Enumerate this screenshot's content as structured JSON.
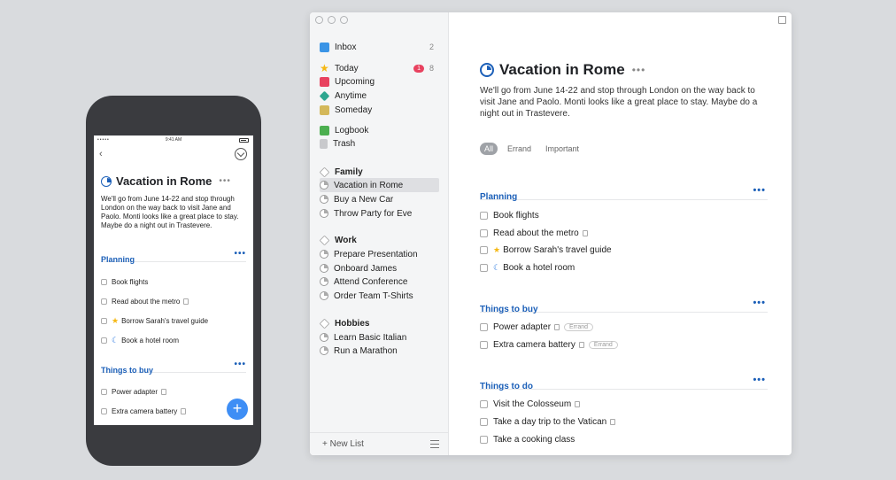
{
  "phone": {
    "status_time": "9:41 AM",
    "status_signal": "•••••",
    "project_title": "Vacation in Rome",
    "title_dots": "•••",
    "description": "We'll go from June 14-22 and stop through London on the way back to visit Jane and Paolo. Monti looks like a great place to stay. Maybe do a night out in Trastevere.",
    "sections": [
      {
        "name": "Planning",
        "dots": "•••"
      },
      {
        "name": "Things to buy",
        "dots": "•••"
      }
    ],
    "tasks": [
      "Book flights",
      "Read about the metro",
      "Borrow Sarah's travel guide",
      "Book a hotel room",
      "Power adapter",
      "Extra camera battery"
    ],
    "fab_icon": "+"
  },
  "sidebar": {
    "inbox": {
      "label": "Inbox",
      "count": "2",
      "icon": "inbox-icon",
      "color": "#3a94e6"
    },
    "today": {
      "label": "Today",
      "badge": "1",
      "count": "8",
      "icon": "star-icon",
      "color": "#f5b814"
    },
    "upcoming": {
      "label": "Upcoming",
      "icon": "calendar-icon",
      "color": "#e8425f"
    },
    "anytime": {
      "label": "Anytime",
      "icon": "layers-icon",
      "color": "#2da68f"
    },
    "someday": {
      "label": "Someday",
      "icon": "archive-box-icon",
      "color": "#d4b85a"
    },
    "logbook": {
      "label": "Logbook",
      "icon": "logbook-icon",
      "color": "#4caf50"
    },
    "trash": {
      "label": "Trash",
      "icon": "trash-icon",
      "color": "#9a9c9f"
    },
    "areas": [
      {
        "label": "Family",
        "projects": [
          "Vacation in Rome",
          "Buy a New Car",
          "Throw Party for Eve"
        ]
      },
      {
        "label": "Work",
        "projects": [
          "Prepare Presentation",
          "Onboard James",
          "Attend Conference",
          "Order Team T-Shirts"
        ]
      },
      {
        "label": "Hobbies",
        "projects": [
          "Learn Basic Italian",
          "Run a Marathon"
        ]
      }
    ],
    "new_list": "+ New List"
  },
  "main": {
    "project_title": "Vacation in Rome",
    "title_dots": "•••",
    "description": "We'll go from June 14-22 and stop through London on the way back to visit Jane and Paolo. Monti looks like a great place to stay. Maybe do a night out in Trastevere.",
    "tags": [
      "All",
      "Errand",
      "Important"
    ],
    "sections": [
      {
        "name": "Planning",
        "dots": "•••",
        "tasks": [
          "Book flights",
          "Read about the metro",
          "Borrow Sarah's travel guide",
          "Book a hotel room"
        ]
      },
      {
        "name": "Things to buy",
        "dots": "•••",
        "tasks": [
          "Power adapter",
          "Extra camera battery"
        ],
        "task_tag": "Errand"
      },
      {
        "name": "Things to do",
        "dots": "•••",
        "tasks": [
          "Visit the Colosseum",
          "Take a day trip to the Vatican",
          "Take a cooking class"
        ]
      }
    ]
  }
}
